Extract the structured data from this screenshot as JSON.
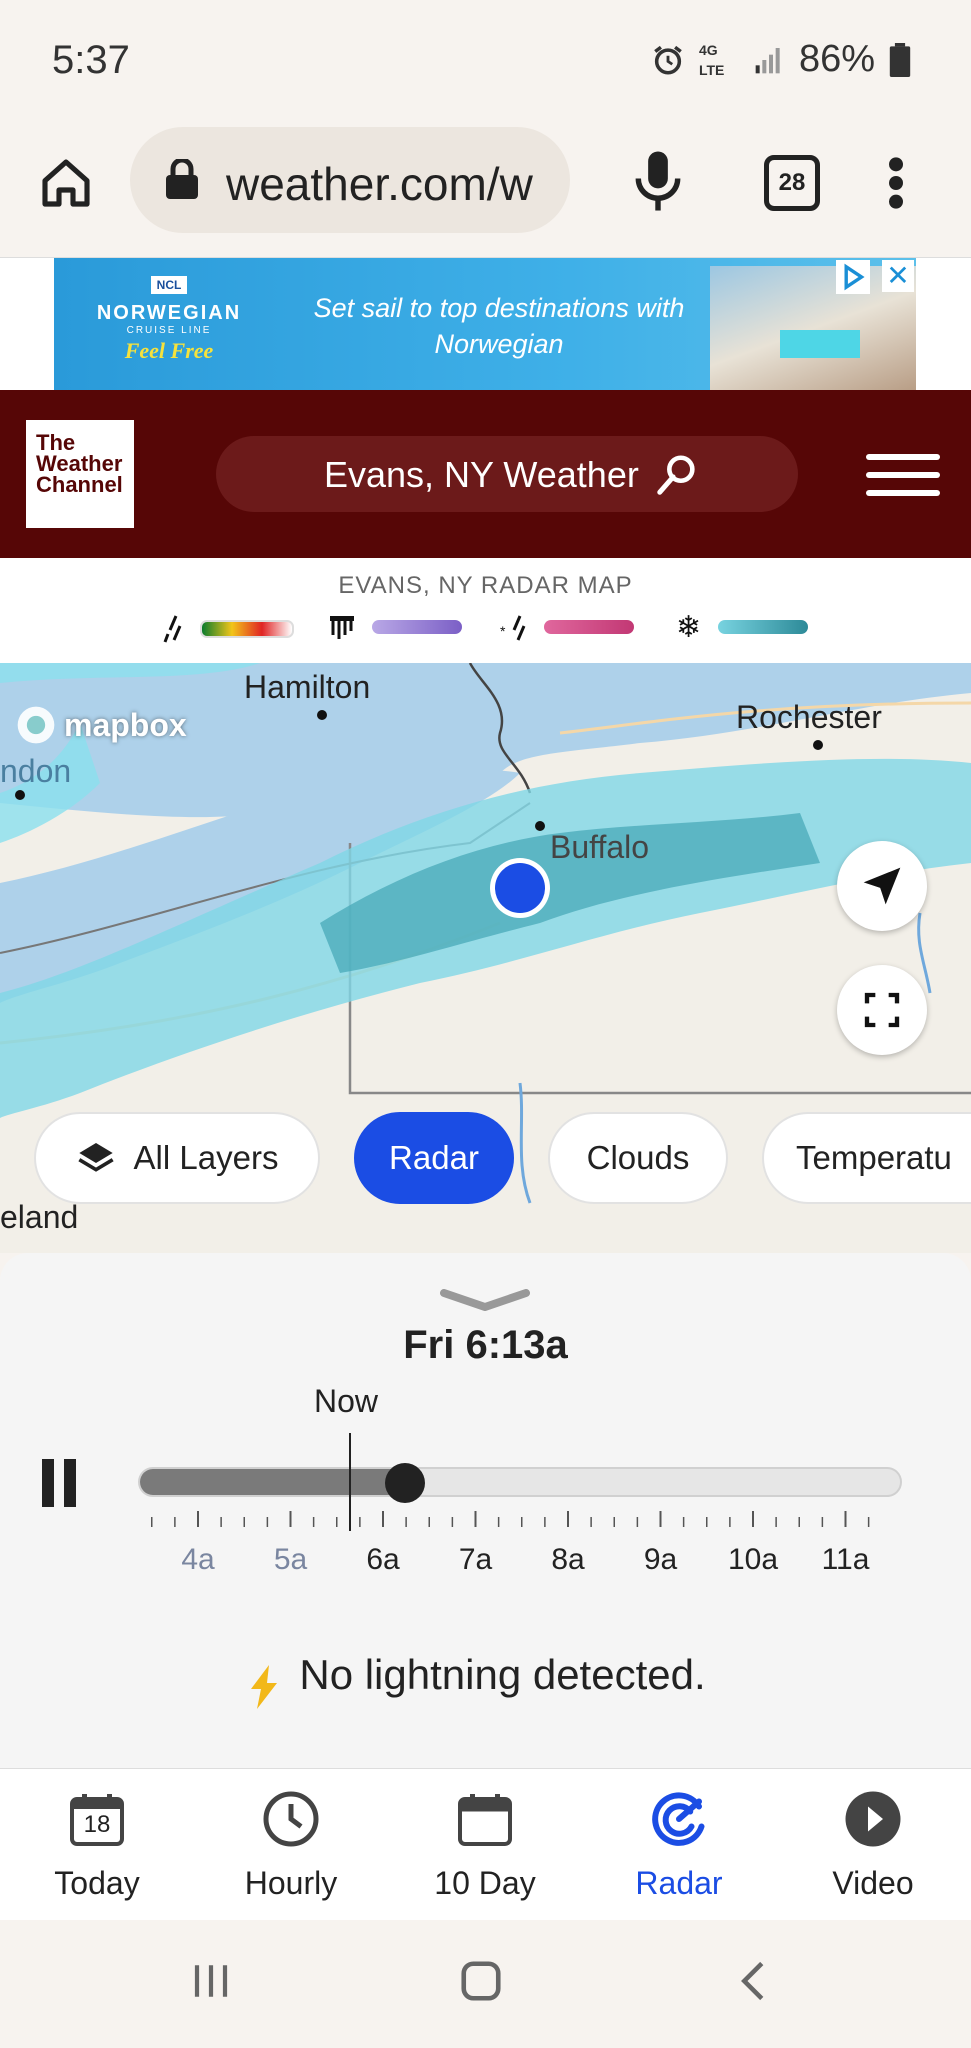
{
  "status_bar": {
    "time": "5:37",
    "network": "4G LTE",
    "battery": "86%"
  },
  "browser": {
    "url": "weather.com/w",
    "tab_count": "28"
  },
  "ad": {
    "brand_badge": "NCL",
    "brand_name": "NORWEGIAN",
    "brand_sub": "CRUISE LINE",
    "brand_tagline": "Feel Free",
    "text": "Set sail to top destinations with Norwegian"
  },
  "header": {
    "logo": "The Weather Channel",
    "search_text": "Evans, NY Weather"
  },
  "radar": {
    "title": "EVANS, NY RADAR MAP",
    "legend": [
      {
        "icon": "rain-icon",
        "colors": [
          "#0b7c2d",
          "#f2c51a",
          "#e02424"
        ]
      },
      {
        "icon": "ice-icon",
        "colors": [
          "#9b84d8",
          "#7b5fc6"
        ]
      },
      {
        "icon": "mix-icon",
        "colors": [
          "#e0679d",
          "#c23874"
        ]
      },
      {
        "icon": "snow-icon",
        "colors": [
          "#78d3e0",
          "#2d8a98"
        ]
      }
    ]
  },
  "map": {
    "cities": [
      "Hamilton",
      "Rochester",
      "Buffalo"
    ],
    "partial_labels": [
      "ndon",
      "eland"
    ],
    "attribution": "mapbox"
  },
  "layers": {
    "chips": [
      "All Layers",
      "Radar",
      "Clouds",
      "Temperatu"
    ],
    "active": "Radar"
  },
  "timeline": {
    "timestamp": "Fri 6:13a",
    "now_label": "Now",
    "tick_labels": [
      "4a",
      "5a",
      "6a",
      "7a",
      "8a",
      "9a",
      "10a",
      "11a"
    ],
    "past_tick_count": 2,
    "progress": 0.35
  },
  "lightning_status": "No lightning detected.",
  "bottom_nav": {
    "items": [
      "Today",
      "Hourly",
      "10 Day",
      "Radar",
      "Video"
    ],
    "today_date": "18",
    "active": "Radar"
  },
  "colors": {
    "header_bg": "#560606",
    "accent": "#1b4de4"
  }
}
